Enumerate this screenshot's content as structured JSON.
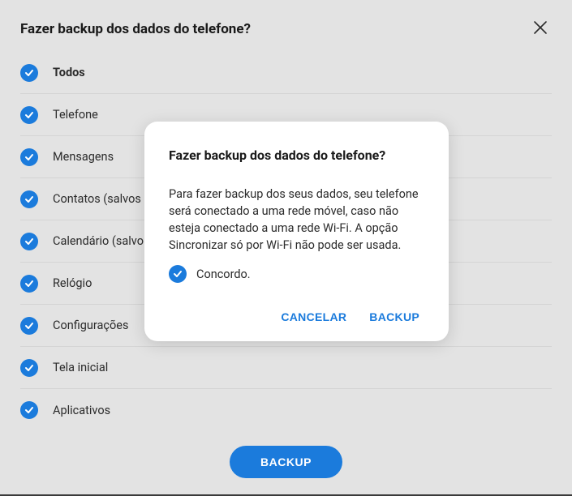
{
  "colors": {
    "accent": "#1b7bdc"
  },
  "header": {
    "title": "Fazer backup dos dados do telefone?"
  },
  "items": [
    {
      "label": "Todos",
      "checked": true
    },
    {
      "label": "Telefone",
      "checked": true
    },
    {
      "label": "Mensagens",
      "checked": true
    },
    {
      "label": "Contatos (salvos no",
      "checked": true
    },
    {
      "label": "Calendário (salvo n",
      "checked": true
    },
    {
      "label": "Relógio",
      "checked": true
    },
    {
      "label": "Configurações",
      "checked": true
    },
    {
      "label": "Tela inicial",
      "checked": true
    },
    {
      "label": "Aplicativos",
      "checked": true
    }
  ],
  "footer": {
    "backup_label": "BACKUP"
  },
  "dialog": {
    "title": "Fazer backup dos dados do telefone?",
    "body": "Para fazer backup dos seus dados, seu telefone será conectado a uma rede móvel, caso não esteja conectado a uma rede Wi-Fi. A opção Sincronizar só por Wi-Fi não pode ser usada.",
    "agree_label": "Concordo.",
    "agree_checked": true,
    "cancel_label": "CANCELAR",
    "confirm_label": "BACKUP"
  }
}
